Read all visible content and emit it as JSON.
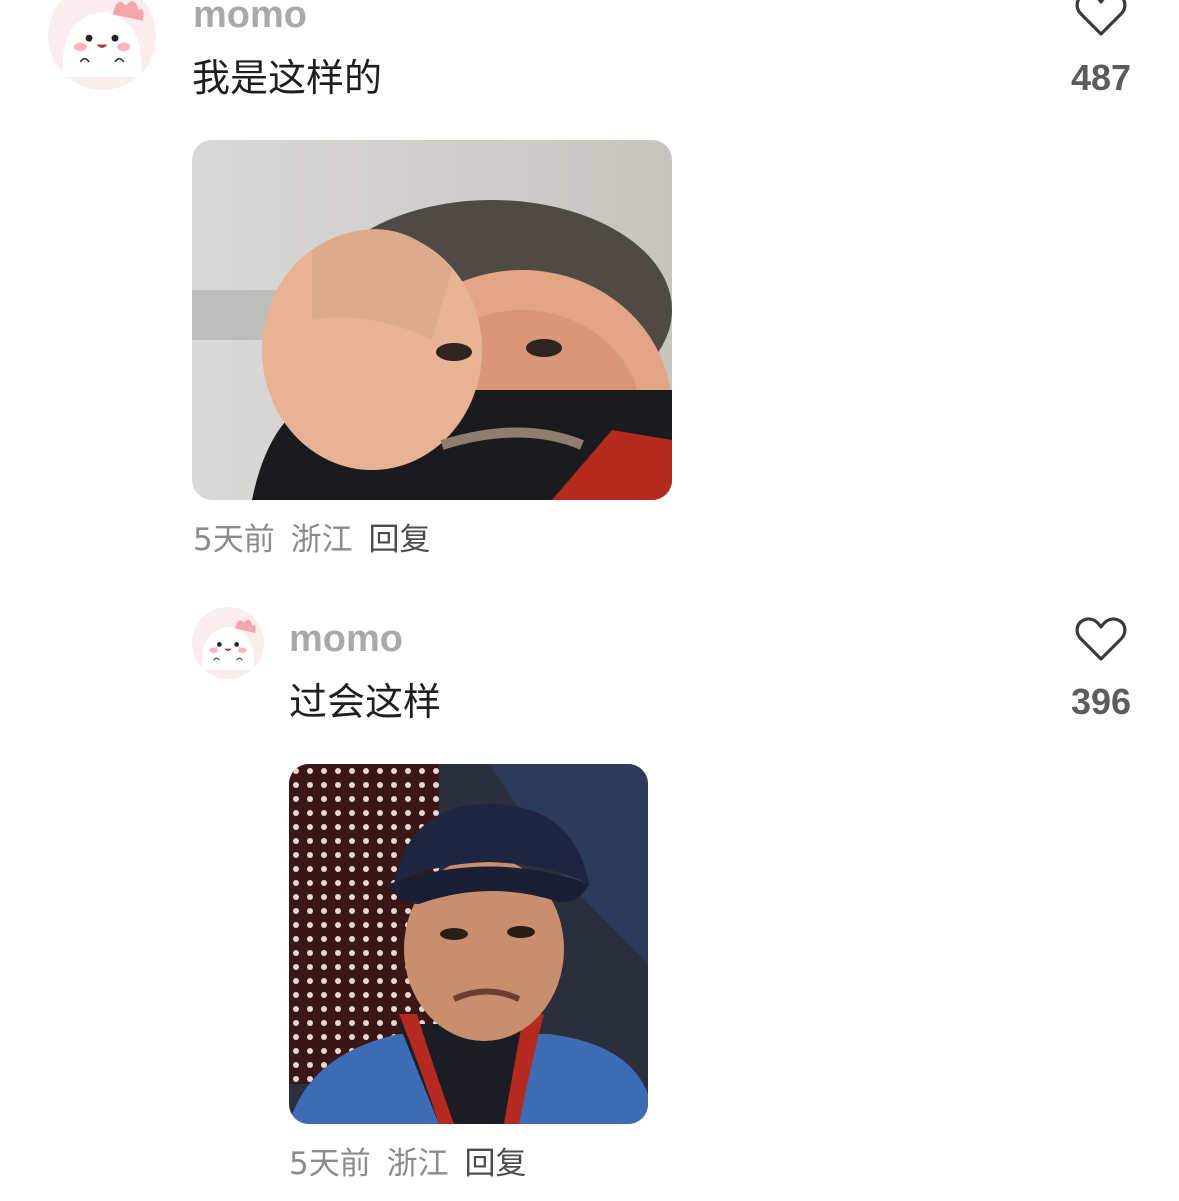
{
  "comments": [
    {
      "username": "momo",
      "text": "我是这样的",
      "likes": "487",
      "time": "5天前",
      "location": "浙江",
      "reply_label": "回复",
      "avatar_icon": "pink-cartoon-avatar-icon",
      "like_icon": "heart-outline-icon"
    },
    {
      "username": "momo",
      "text": "过会这样",
      "likes": "396",
      "time": "5天前",
      "location": "浙江",
      "reply_label": "回复",
      "avatar_icon": "pink-cartoon-avatar-icon",
      "like_icon": "heart-outline-icon"
    }
  ],
  "colors": {
    "username": "#a9a9a9",
    "text": "#1f1f1f",
    "likes": "#5c5c5c",
    "meta": "#8b8b8b"
  }
}
